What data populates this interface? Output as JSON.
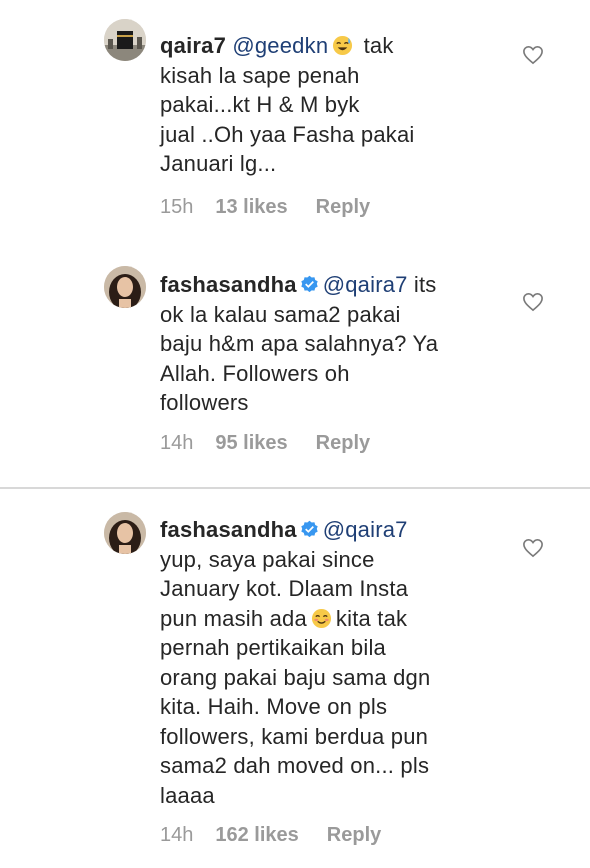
{
  "comments": [
    {
      "username": "qaira7",
      "verified": false,
      "mention": "@geedkn",
      "emoji": "sweat-smile-emoji",
      "text_after_emoji": " tak\nkisah la sape penah\npakai...kt H & M byk\njual ..Oh yaa Fasha pakai\nJanuari lg...",
      "time": "15h",
      "likes": "13 likes",
      "reply": "Reply"
    },
    {
      "username": "fashasandha",
      "verified": true,
      "mention": "@qaira7",
      "text_after_mention": " its\nok la kalau sama2 pakai\nbaju h&m apa salahnya? Ya\nAllah. Followers oh\nfollowers",
      "time": "14h",
      "likes": "95 likes",
      "reply": "Reply"
    },
    {
      "username": "fashasandha",
      "verified": true,
      "mention": "@qaira7",
      "text_line_1": "\nyup, saya pakai since\nJanuary kot. Dlaam Insta\npun masih ada",
      "emoji": "smiling-face-emoji",
      "text_after_emoji": "kita tak\npernah pertikaikan bila\norang pakai baju sama dgn\nkita. Haih. Move on pls\nfollowers, kami berdua pun\nsama2 dah moved on... pls\nlaaaa",
      "time": "14h",
      "likes": "162 likes",
      "reply": "Reply"
    }
  ],
  "colors": {
    "text": "#262626",
    "meta": "#9a9a9a",
    "mention": "#1f3f75",
    "verified": "#3897f0",
    "divider": "#d8d8d8"
  }
}
